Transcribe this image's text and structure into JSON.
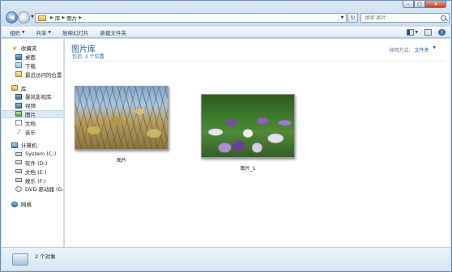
{
  "window": {
    "caption_buttons": {
      "minimize": "–",
      "maximize": "□",
      "close": "✕"
    }
  },
  "navigation": {
    "address_crumbs": [
      "库",
      "图片"
    ],
    "search_placeholder": "搜索 图片",
    "refresh_glyph": "↻"
  },
  "toolbar": {
    "organize": "组织",
    "share": "共享",
    "slideshow": "放映幻灯片",
    "new_folder": "新建文件夹"
  },
  "sidebar": {
    "favorites": {
      "label": "收藏夹",
      "items": [
        "桌面",
        "下载",
        "最近访问的位置"
      ]
    },
    "libraries": {
      "label": "库",
      "items": [
        "暴风影视库",
        "视频",
        "图片",
        "文档",
        "音乐"
      ],
      "selected": "图片"
    },
    "computer": {
      "label": "计算机",
      "items": [
        "System (C:)",
        "软件 (D:)",
        "文档 (E:)",
        "娱乐 (F:)",
        "DVD 驱动器 (G:) M"
      ]
    },
    "network": {
      "label": "网络"
    }
  },
  "library": {
    "title": "图片库",
    "includes_prefix": "包括:",
    "includes_locations": "2 个位置",
    "arrange_label": "排列方式:",
    "arrange_value": "文件夹"
  },
  "files": [
    {
      "name": "图片",
      "thumbnail": "plants-photo"
    },
    {
      "name": "图片_1",
      "thumbnail": "iris-photo"
    }
  ],
  "details": {
    "count_text": "2 个对象"
  }
}
